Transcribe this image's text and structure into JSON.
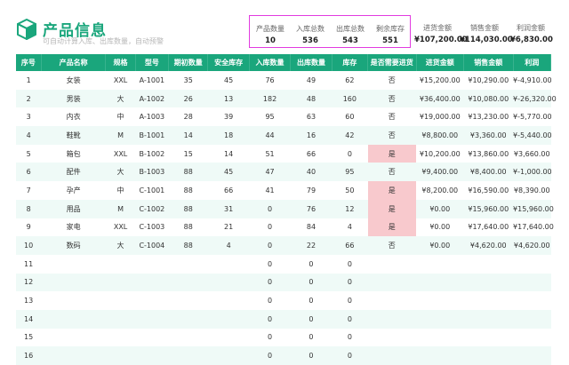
{
  "title": "产品信息",
  "subtitle": "可自动计算入库、出库数量，自动预警",
  "summary": [
    {
      "label": "产品数量",
      "value": "10"
    },
    {
      "label": "入库总数",
      "value": "536"
    },
    {
      "label": "出库总数",
      "value": "543"
    },
    {
      "label": "剩余库存",
      "value": "551"
    }
  ],
  "amounts": [
    {
      "label": "进货金额",
      "value": "¥107,200.00"
    },
    {
      "label": "销售金额",
      "value": "¥114,030.00"
    },
    {
      "label": "利润金额",
      "value": "¥6,830.00"
    }
  ],
  "columns": [
    "序号",
    "产品名称",
    "规格",
    "型号",
    "期初数量",
    "安全库存",
    "入库数量",
    "出库数量",
    "库存",
    "是否需要进货",
    "进货金额",
    "销售金额",
    "利润"
  ],
  "rows": [
    [
      "1",
      "女装",
      "XXL",
      "A-1001",
      "35",
      "45",
      "76",
      "49",
      "62",
      "否",
      "¥15,200.00",
      "¥10,290.00",
      "¥-4,910.00"
    ],
    [
      "2",
      "男装",
      "大",
      "A-1002",
      "26",
      "13",
      "182",
      "48",
      "160",
      "否",
      "¥36,400.00",
      "¥10,080.00",
      "¥-26,320.00"
    ],
    [
      "3",
      "内衣",
      "中",
      "A-1003",
      "28",
      "39",
      "95",
      "63",
      "60",
      "否",
      "¥19,000.00",
      "¥13,230.00",
      "¥-5,770.00"
    ],
    [
      "4",
      "鞋靴",
      "M",
      "B-1001",
      "14",
      "18",
      "44",
      "16",
      "42",
      "否",
      "¥8,800.00",
      "¥3,360.00",
      "¥-5,440.00"
    ],
    [
      "5",
      "箱包",
      "XXL",
      "B-1002",
      "15",
      "14",
      "51",
      "66",
      "0",
      "是",
      "¥10,200.00",
      "¥13,860.00",
      "¥3,660.00"
    ],
    [
      "6",
      "配件",
      "大",
      "B-1003",
      "88",
      "45",
      "47",
      "40",
      "95",
      "否",
      "¥9,400.00",
      "¥8,400.00",
      "¥-1,000.00"
    ],
    [
      "7",
      "孕产",
      "中",
      "C-1001",
      "88",
      "66",
      "41",
      "79",
      "50",
      "是",
      "¥8,200.00",
      "¥16,590.00",
      "¥8,390.00"
    ],
    [
      "8",
      "用品",
      "M",
      "C-1002",
      "88",
      "31",
      "0",
      "76",
      "12",
      "是",
      "¥0.00",
      "¥15,960.00",
      "¥15,960.00"
    ],
    [
      "9",
      "家电",
      "XXL",
      "C-1003",
      "88",
      "21",
      "0",
      "84",
      "4",
      "是",
      "¥0.00",
      "¥17,640.00",
      "¥17,640.00"
    ],
    [
      "10",
      "数码",
      "大",
      "C-1004",
      "88",
      "4",
      "0",
      "22",
      "66",
      "否",
      "¥0.00",
      "¥4,620.00",
      "¥4,620.00"
    ],
    [
      "11",
      "",
      "",
      "",
      "",
      "",
      "0",
      "0",
      "0",
      "",
      "",
      "",
      ""
    ],
    [
      "12",
      "",
      "",
      "",
      "",
      "",
      "0",
      "0",
      "0",
      "",
      "",
      "",
      ""
    ],
    [
      "13",
      "",
      "",
      "",
      "",
      "",
      "0",
      "0",
      "0",
      "",
      "",
      "",
      ""
    ],
    [
      "14",
      "",
      "",
      "",
      "",
      "",
      "0",
      "0",
      "0",
      "",
      "",
      "",
      ""
    ],
    [
      "15",
      "",
      "",
      "",
      "",
      "",
      "0",
      "0",
      "0",
      "",
      "",
      "",
      ""
    ],
    [
      "16",
      "",
      "",
      "",
      "",
      "",
      "0",
      "0",
      "0",
      "",
      "",
      "",
      ""
    ]
  ],
  "colors": {
    "accent": "#1aa67c",
    "negative": "#e4262b",
    "alert_bg": "#f8c9cd",
    "summary_border": "#e23be0",
    "row_alt": "#effaf7"
  }
}
